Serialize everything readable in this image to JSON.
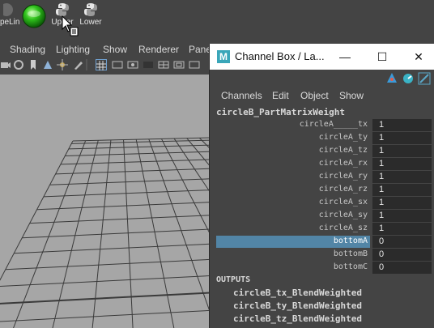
{
  "shelf": {
    "items": [
      {
        "label": "peLin",
        "icon": "sphere-icon"
      },
      {
        "label": "",
        "icon": "green-sphere-icon"
      },
      {
        "label": "Upper",
        "icon": "python-script-icon"
      },
      {
        "label": "Lower",
        "icon": "python-script-icon"
      }
    ]
  },
  "viewport_menu": {
    "items": [
      "Shading",
      "Lighting",
      "Show",
      "Renderer",
      "Pane"
    ]
  },
  "channel_box": {
    "title": "Channel Box / La...",
    "window_controls": {
      "minimize": "—",
      "maximize": "☐",
      "close": "✕"
    },
    "menus": [
      "Channels",
      "Edit",
      "Object",
      "Show"
    ],
    "node_name": "circleB_PartMatrixWeight",
    "channels": [
      {
        "name": "circleA_____tx",
        "value": "1",
        "selected": false
      },
      {
        "name": "circleA_ty",
        "value": "1",
        "selected": false
      },
      {
        "name": "circleA_tz",
        "value": "1",
        "selected": false
      },
      {
        "name": "circleA_rx",
        "value": "1",
        "selected": false
      },
      {
        "name": "circleA_ry",
        "value": "1",
        "selected": false
      },
      {
        "name": "circleA_rz",
        "value": "1",
        "selected": false
      },
      {
        "name": "circleA_sx",
        "value": "1",
        "selected": false
      },
      {
        "name": "circleA_sy",
        "value": "1",
        "selected": false
      },
      {
        "name": "circleA_sz",
        "value": "1",
        "selected": false
      },
      {
        "name": "bottomA",
        "value": "0",
        "selected": true
      },
      {
        "name": "bottomB",
        "value": "0",
        "selected": false
      },
      {
        "name": "bottomC",
        "value": "0",
        "selected": false
      }
    ],
    "outputs_heading": "OUTPUTS",
    "outputs": [
      "circleB_tx_BlendWeighted",
      "circleB_ty_BlendWeighted",
      "circleB_tz_BlendWeighted"
    ]
  },
  "colors": {
    "selection": "#5285a6",
    "panel": "#444444",
    "viewport": "#a6a6a6",
    "field": "#2b2b2b"
  }
}
